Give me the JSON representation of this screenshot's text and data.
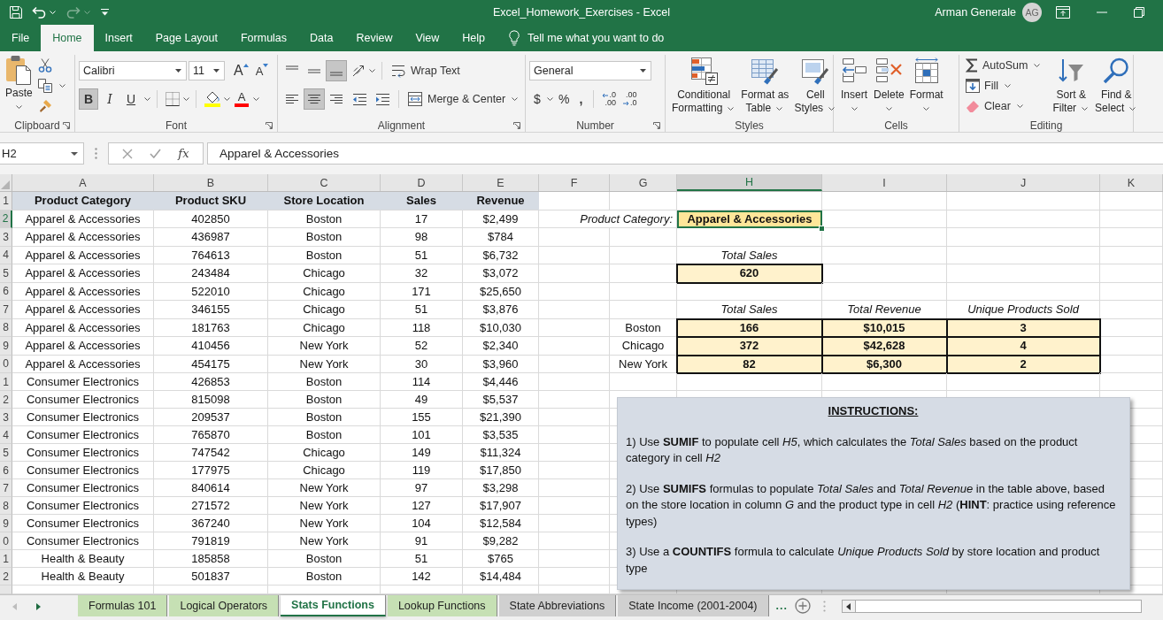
{
  "window": {
    "title": "Excel_Homework_Exercises - Excel",
    "user": "Arman Generale",
    "initials": "AG"
  },
  "quick_access": [
    {
      "kind": "save",
      "disabled": false
    },
    {
      "kind": "undo",
      "disabled": false
    },
    {
      "kind": "redo",
      "disabled": true
    },
    {
      "kind": "customize",
      "disabled": false
    }
  ],
  "ribbon_tabs": [
    {
      "label": "File",
      "selected": false
    },
    {
      "label": "Home",
      "selected": true
    },
    {
      "label": "Insert",
      "selected": false
    },
    {
      "label": "Page Layout",
      "selected": false
    },
    {
      "label": "Formulas",
      "selected": false
    },
    {
      "label": "Data",
      "selected": false
    },
    {
      "label": "Review",
      "selected": false
    },
    {
      "label": "View",
      "selected": false
    },
    {
      "label": "Help",
      "selected": false
    }
  ],
  "tell_me": "Tell me what you want to do",
  "ribbon": {
    "clipboard": {
      "label": "Clipboard",
      "launcher": true,
      "paste": "Paste"
    },
    "font": {
      "label": "Font",
      "launcher": true,
      "font_name": "Calibri",
      "font_size": "11",
      "grow": "A",
      "shrink": "A",
      "toggles": [
        {
          "kind": "bold",
          "label": "B",
          "pressed": true
        },
        {
          "kind": "italic",
          "label": "I",
          "pressed": false
        },
        {
          "kind": "underline",
          "label": "U",
          "pressed": false
        }
      ],
      "font_color": "A"
    },
    "alignment": {
      "label": "Alignment",
      "launcher": true,
      "vertical": [
        {
          "kind": "top",
          "pressed": false
        },
        {
          "kind": "middle",
          "pressed": false
        },
        {
          "kind": "bottom",
          "pressed": true
        }
      ],
      "horizontal": [
        {
          "kind": "left",
          "pressed": false
        },
        {
          "kind": "center",
          "pressed": true
        },
        {
          "kind": "right",
          "pressed": false
        }
      ],
      "wrap_text": "Wrap Text",
      "merge": "Merge & Center"
    },
    "number": {
      "label": "Number",
      "launcher": true,
      "format": "General",
      "currency": "$",
      "percent": "%",
      "comma": ",",
      "decimals": [
        {
          "kind": "increase",
          "top": ".0",
          "bottom": ".00"
        },
        {
          "kind": "decrease",
          "top": ".00",
          "bottom": ".0"
        }
      ]
    },
    "styles": {
      "label": "Styles",
      "buttons": [
        {
          "kind": "conditional",
          "lines": [
            "Conditional",
            "Formatting"
          ]
        },
        {
          "kind": "table",
          "lines": [
            "Format as",
            "Table"
          ]
        },
        {
          "kind": "cell_styles",
          "lines": [
            "Cell",
            "Styles"
          ]
        }
      ]
    },
    "cells": {
      "label": "Cells",
      "buttons": [
        {
          "kind": "insert",
          "label": "Insert"
        },
        {
          "kind": "delete",
          "label": "Delete"
        },
        {
          "kind": "format",
          "label": "Format"
        }
      ]
    },
    "editing": {
      "label": "Editing",
      "small": [
        {
          "kind": "autosum",
          "label": "AutoSum"
        },
        {
          "kind": "fill",
          "label": "Fill"
        },
        {
          "kind": "clear",
          "label": "Clear"
        }
      ],
      "big": [
        {
          "kind": "sort",
          "lines": [
            "Sort &",
            "Filter"
          ]
        },
        {
          "kind": "find",
          "lines": [
            "Find &",
            "Select"
          ]
        }
      ]
    }
  },
  "formula_bar": {
    "name_box": "H2",
    "fx": "fx",
    "content": "Apparel & Accessories"
  },
  "sheet": {
    "column_headers": [
      {
        "label": "A",
        "selected": false
      },
      {
        "label": "B",
        "selected": false
      },
      {
        "label": "C",
        "selected": false
      },
      {
        "label": "D",
        "selected": false
      },
      {
        "label": "E",
        "selected": false
      },
      {
        "label": "F",
        "selected": false
      },
      {
        "label": "G",
        "selected": false
      },
      {
        "label": "H",
        "selected": true
      },
      {
        "label": "I",
        "selected": false
      },
      {
        "label": "J",
        "selected": false
      },
      {
        "label": "K",
        "selected": false
      }
    ],
    "row_headers": [
      {
        "label": "1",
        "selected": false
      },
      {
        "label": "2",
        "selected": true
      },
      {
        "label": "3",
        "selected": false
      },
      {
        "label": "4",
        "selected": false
      },
      {
        "label": "5",
        "selected": false
      },
      {
        "label": "6",
        "selected": false
      },
      {
        "label": "7",
        "selected": false
      },
      {
        "label": "8",
        "selected": false
      },
      {
        "label": "9",
        "selected": false
      },
      {
        "label": "0",
        "selected": false
      },
      {
        "label": "1",
        "selected": false
      },
      {
        "label": "2",
        "selected": false
      },
      {
        "label": "3",
        "selected": false
      },
      {
        "label": "4",
        "selected": false
      },
      {
        "label": "5",
        "selected": false
      },
      {
        "label": "6",
        "selected": false
      },
      {
        "label": "7",
        "selected": false
      },
      {
        "label": "8",
        "selected": false
      },
      {
        "label": "9",
        "selected": false
      },
      {
        "label": "0",
        "selected": false
      },
      {
        "label": "1",
        "selected": false
      },
      {
        "label": "2",
        "selected": false
      }
    ],
    "table": {
      "columns": [
        "Product Category",
        "Product SKU",
        "Store Location",
        "Sales",
        "Revenue"
      ],
      "rows": [
        [
          "Apparel & Accessories",
          "402850",
          "Boston",
          "17",
          "$2,499"
        ],
        [
          "Apparel & Accessories",
          "436987",
          "Boston",
          "98",
          "$784"
        ],
        [
          "Apparel & Accessories",
          "764613",
          "Boston",
          "51",
          "$6,732"
        ],
        [
          "Apparel & Accessories",
          "243484",
          "Chicago",
          "32",
          "$3,072"
        ],
        [
          "Apparel & Accessories",
          "522010",
          "Chicago",
          "171",
          "$25,650"
        ],
        [
          "Apparel & Accessories",
          "346155",
          "Chicago",
          "51",
          "$3,876"
        ],
        [
          "Apparel & Accessories",
          "181763",
          "Chicago",
          "118",
          "$10,030"
        ],
        [
          "Apparel & Accessories",
          "410456",
          "New York",
          "52",
          "$2,340"
        ],
        [
          "Apparel & Accessories",
          "454175",
          "New York",
          "30",
          "$3,960"
        ],
        [
          "Consumer Electronics",
          "426853",
          "Boston",
          "114",
          "$4,446"
        ],
        [
          "Consumer Electronics",
          "815098",
          "Boston",
          "49",
          "$5,537"
        ],
        [
          "Consumer Electronics",
          "209537",
          "Boston",
          "155",
          "$21,390"
        ],
        [
          "Consumer Electronics",
          "765870",
          "Boston",
          "101",
          "$3,535"
        ],
        [
          "Consumer Electronics",
          "747542",
          "Chicago",
          "149",
          "$11,324"
        ],
        [
          "Consumer Electronics",
          "177975",
          "Chicago",
          "119",
          "$17,850"
        ],
        [
          "Consumer Electronics",
          "840614",
          "New York",
          "97",
          "$3,298"
        ],
        [
          "Consumer Electronics",
          "271572",
          "New York",
          "127",
          "$17,907"
        ],
        [
          "Consumer Electronics",
          "367240",
          "New York",
          "104",
          "$12,584"
        ],
        [
          "Consumer Electronics",
          "791819",
          "New York",
          "91",
          "$9,282"
        ],
        [
          "Health & Beauty",
          "185858",
          "Boston",
          "51",
          "$765"
        ],
        [
          "Health & Beauty",
          "501837",
          "Boston",
          "142",
          "$14,484"
        ]
      ]
    },
    "summary": {
      "category": {
        "label": "Product Category:",
        "value": "Apparel & Accessories",
        "selected": true
      },
      "total_sales": {
        "heading": "Total Sales",
        "value": "620"
      },
      "by_store": {
        "columns": [
          "Total Sales",
          "Total Revenue",
          "Unique Products Sold"
        ],
        "rows": [
          {
            "store": "Boston",
            "values": [
              "166",
              "$10,015",
              "3"
            ]
          },
          {
            "store": "Chicago",
            "values": [
              "372",
              "$42,628",
              "4"
            ]
          },
          {
            "store": "New York",
            "values": [
              "82",
              "$6,300",
              "2"
            ]
          }
        ]
      }
    },
    "instructions": {
      "title": "INSTRUCTIONS:",
      "paragraphs": [
        "1) Use **SUMIF** to populate cell *H5*, which calculates the *Total Sales* based on the product category in cell *H2*",
        "2) Use **SUMIFS** formulas to populate *Total Sales* and *Total Revenue* in the table above, based on the store location in column *G* and the product type in cell *H2* (**HINT**: practice using reference types)",
        "3) Use a **COUNTIFS** formula to calculate *Unique Products Sold* by store location and product type"
      ]
    }
  },
  "sheet_tabs": [
    {
      "label": "Formulas 101",
      "selected": false,
      "color": "#c6e0b4"
    },
    {
      "label": "Logical Operators",
      "selected": false,
      "color": "#c6e0b4"
    },
    {
      "label": "Stats Functions",
      "selected": true
    },
    {
      "label": "Lookup Functions",
      "selected": false,
      "color": "#c6e0b4"
    },
    {
      "label": "State Abbreviations",
      "selected": false,
      "color": "#d0d0d0"
    },
    {
      "label": "State Income (2001-2004)",
      "selected": false,
      "color": "#d0d0d0"
    }
  ],
  "more_tabs": "..."
}
